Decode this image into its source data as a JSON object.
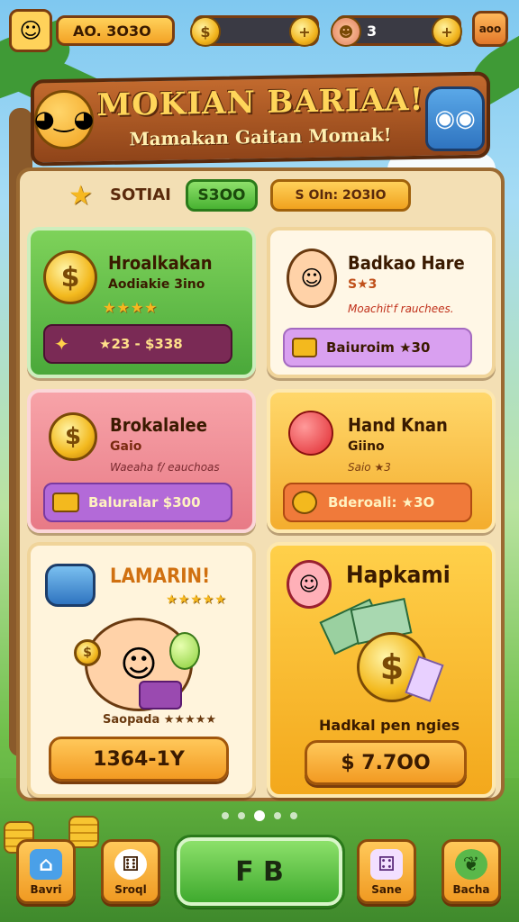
{
  "topbar": {
    "coins_label": "AO. 3O3O",
    "energy_value": "3",
    "menu_label": "aoo"
  },
  "banner": {
    "title": "MOKIAN BARIAA!",
    "subtitle": "Mamakan Gaitan Momak!"
  },
  "panel_header": {
    "label": "SOTIAI",
    "green_value": "S3OO",
    "gold_value": "S  OIn: 2O3IO"
  },
  "cards": [
    {
      "title": "Hroalkakan",
      "subtitle": "Aodiakie 3ino",
      "stars": "★★★★",
      "bar_label": "★23 - $338"
    },
    {
      "title": "Badkao Hare",
      "subtitle": "S★3",
      "desc": "Moachit'f rauchees.",
      "bar_label": "Baiuroim ★30"
    },
    {
      "title": "Brokalalee",
      "subtitle": "Gaio",
      "desc": "Waeaha f/ eauchoas",
      "bar_label": "Baluralar  $300"
    },
    {
      "title": "Hand Knan",
      "subtitle": "Giino",
      "desc": "Saio ★3",
      "bar_label": "Bderoali: ★3O"
    },
    {
      "title": "LAMARIN!",
      "stars_top": "★★★★★",
      "caption": "Saopada ★★★★★",
      "button_label": "1364-1Y"
    },
    {
      "title": "Hapkami",
      "caption": "Hadkal pen ngies",
      "button_label": "$ 7.7OO"
    }
  ],
  "bottom_nav": {
    "items": [
      {
        "label": "Bavri",
        "icon": "home-icon"
      },
      {
        "label": "Sroql",
        "icon": "dice-icon"
      },
      {
        "label": "F B",
        "icon": "play"
      },
      {
        "label": "Sane",
        "icon": "cube-icon"
      },
      {
        "label": "Bacha",
        "icon": "leaf-icon"
      }
    ]
  },
  "colors": {
    "panel": "#f3dfb4",
    "wood": "#9b6a32",
    "gold": "#f6b820",
    "green": "#4aa83a"
  }
}
